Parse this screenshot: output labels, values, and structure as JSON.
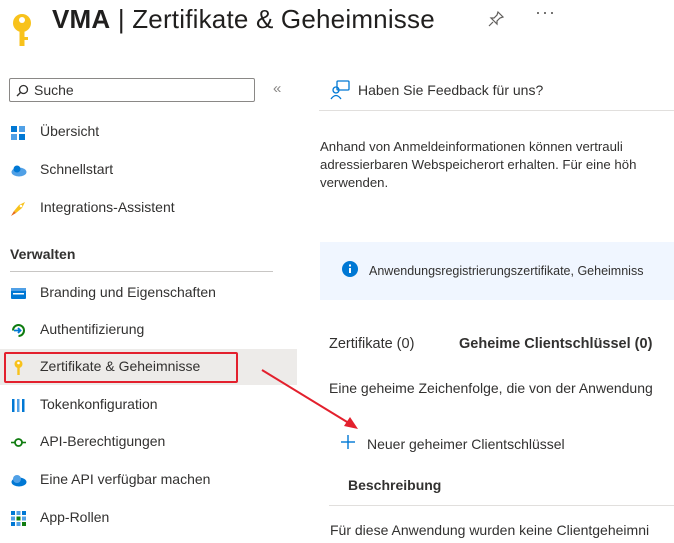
{
  "header": {
    "title_app": "VMA",
    "title_sep": " | ",
    "title_page": "Zertifikate & Geheimnisse",
    "more": "···"
  },
  "sidebar": {
    "search_placeholder": "Suche",
    "collapse": "«",
    "items": [
      {
        "label": "Übersicht",
        "icon": "overview-grid-icon"
      },
      {
        "label": "Schnellstart",
        "icon": "cloud-quickstart-icon"
      },
      {
        "label": "Integrations-Assistent",
        "icon": "rocket-icon"
      }
    ],
    "section": "Verwalten",
    "manage_items": [
      {
        "label": "Branding und Eigenschaften",
        "icon": "branding-icon"
      },
      {
        "label": "Authentifizierung",
        "icon": "authentication-icon"
      },
      {
        "label": "Zertifikate & Geheimnisse",
        "icon": "key-icon",
        "selected": true
      },
      {
        "label": "Tokenkonfiguration",
        "icon": "token-bars-icon"
      },
      {
        "label": "API-Berechtigungen",
        "icon": "api-permissions-icon"
      },
      {
        "label": "Eine API verfügbar machen",
        "icon": "cloud-api-icon"
      },
      {
        "label": "App-Rollen",
        "icon": "app-roles-grid-icon"
      }
    ]
  },
  "main": {
    "feedback": "Haben Sie Feedback für uns?",
    "description_lines": [
      "Anhand von Anmeldeinformationen können vertrauli",
      "adressierbaren Webspeicherort erhalten. Für eine höh",
      "verwenden."
    ],
    "info_text": "Anwendungsregistrierungszertifikate, Geheimniss",
    "tabs": [
      {
        "label": "Zertifikate (0)",
        "active": false
      },
      {
        "label": "Geheime Clientschlüssel (0)",
        "active": true
      }
    ],
    "secret_description": "Eine geheime Zeichenfolge, die von der Anwendung",
    "add_button": "Neuer geheimer Clientschlüssel",
    "column_header": "Beschreibung",
    "empty_text": "Für diese Anwendung wurden keine Clientgeheimni"
  },
  "colors": {
    "accent": "#0078d4",
    "highlight_border": "#e3202d",
    "selected_bg": "#edebe9",
    "info_bg": "#f0f6ff"
  }
}
